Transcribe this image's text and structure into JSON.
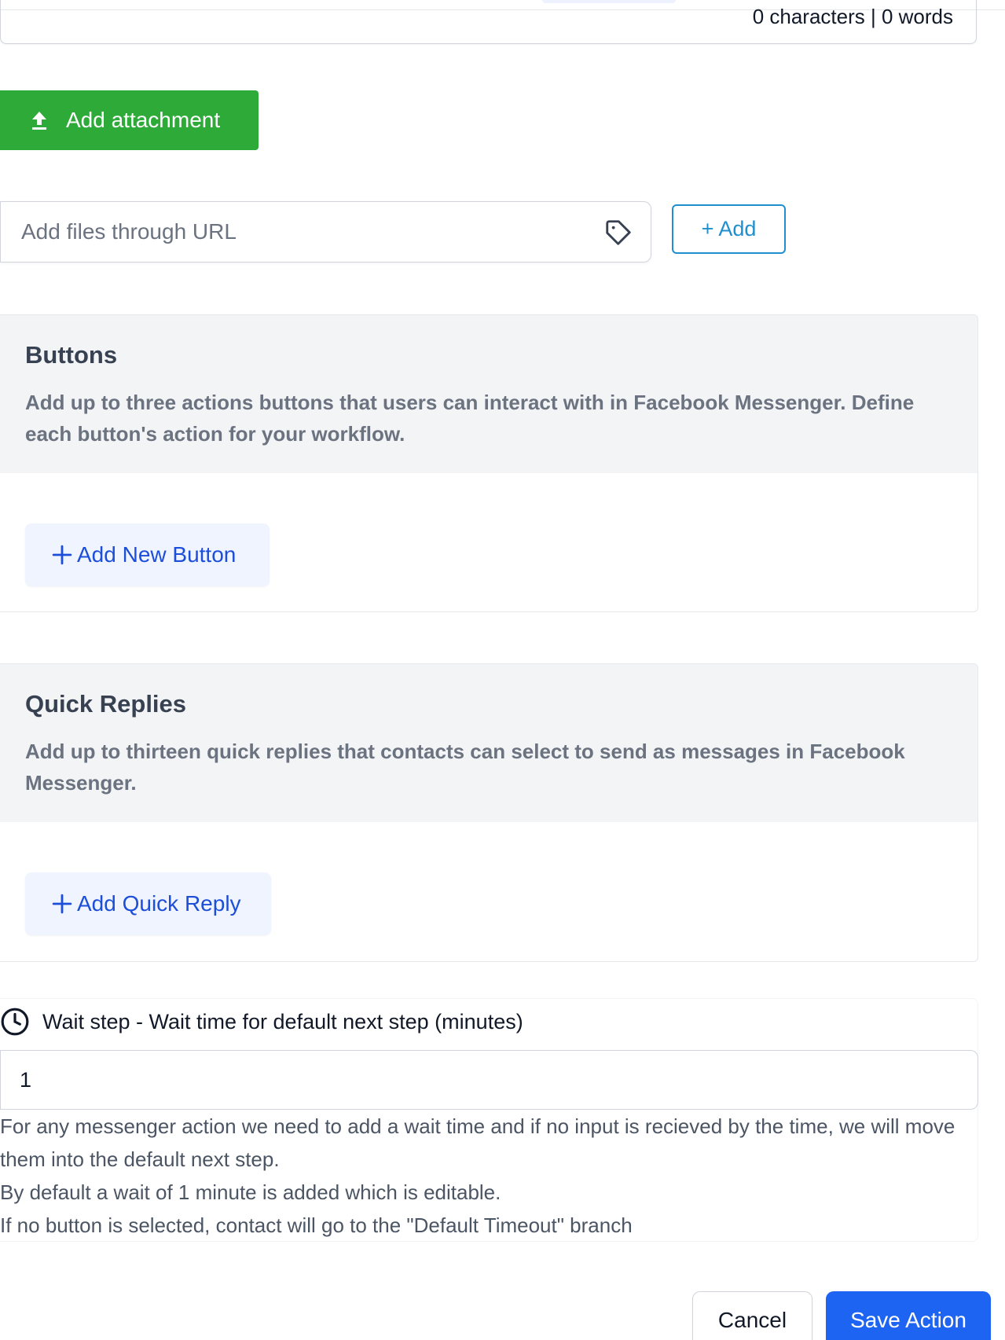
{
  "editor": {
    "char_count": "0 characters | 0 words"
  },
  "attachment": {
    "button_label": "Add attachment",
    "icon": "upload-icon"
  },
  "url_files": {
    "placeholder": "Add files through URL",
    "value": "",
    "tag_icon": "tag-icon",
    "add_label": "+ Add"
  },
  "buttons_panel": {
    "title": "Buttons",
    "description": "Add up to three actions buttons that users can interact with in Facebook Messenger. Define each button's action for your workflow.",
    "add_label": "Add New Button"
  },
  "quick_replies_panel": {
    "title": "Quick Replies",
    "description": "Add up to thirteen quick replies that contacts can select to send as messages in Facebook Messenger.",
    "add_label": "Add Quick Reply"
  },
  "wait_step": {
    "label": "Wait step - Wait time for default next step (minutes)",
    "value": "1",
    "help": [
      "For any messenger action we need to add a wait time and if no input is recieved by the time, we will move them into the default next step.",
      "By default a wait of 1 minute is added which is editable.",
      "If no button is selected, contact will go to the \"Default Timeout\" branch"
    ]
  },
  "footer": {
    "cancel_label": "Cancel",
    "save_label": "Save Action"
  },
  "colors": {
    "attach_green": "#2eaa39",
    "add_outline_blue": "#1f8fce",
    "soft_button_bg": "#eff4ff",
    "soft_button_text": "#1d4ed8",
    "primary_blue": "#1d64f2",
    "panel_header_bg": "#f3f4f6"
  }
}
